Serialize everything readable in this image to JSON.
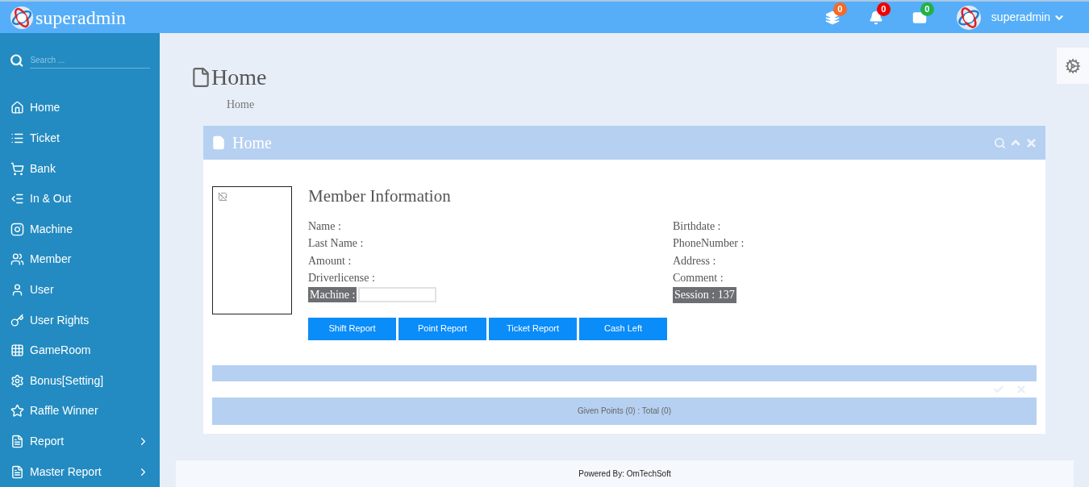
{
  "header": {
    "brand": "superadmin",
    "user": "superadmin",
    "badges": [
      {
        "count": "0",
        "color": "#f26b2a"
      },
      {
        "count": "0",
        "color": "#f00000"
      },
      {
        "count": "0",
        "color": "#22b04a"
      }
    ]
  },
  "sidebar": {
    "search": {
      "placeholder": "Search ..."
    },
    "items": [
      {
        "label": "Home",
        "submenu": false
      },
      {
        "label": "Ticket",
        "submenu": false
      },
      {
        "label": "Bank",
        "submenu": false
      },
      {
        "label": "In & Out",
        "submenu": false
      },
      {
        "label": "Machine",
        "submenu": false
      },
      {
        "label": "Member",
        "submenu": false
      },
      {
        "label": "User",
        "submenu": false
      },
      {
        "label": "User Rights",
        "submenu": false
      },
      {
        "label": "GameRoom",
        "submenu": false
      },
      {
        "label": "Bonus[Setting]",
        "submenu": false
      },
      {
        "label": "Raffle Winner",
        "submenu": false
      },
      {
        "label": "Report",
        "submenu": true
      },
      {
        "label": "Master Report",
        "submenu": true
      }
    ]
  },
  "page": {
    "title": "Home",
    "breadcrumb": "Home"
  },
  "panel": {
    "title": "Home",
    "heading": "Member Information",
    "left_fields": [
      "Name :",
      "Last Name :",
      "Amount :",
      "Driverlicense :"
    ],
    "machine_label": "Machine :",
    "right_fields": [
      "Birthdate :",
      "PhoneNumber :",
      "Address :",
      "Comment :"
    ],
    "session": "Session : 137",
    "buttons": [
      "Shift Report",
      "Point Report",
      "Ticket Report",
      "Cash Left"
    ],
    "summary": "Given Points (0) : Total (0)"
  },
  "footer": "Powered By: OmTechSoft"
}
